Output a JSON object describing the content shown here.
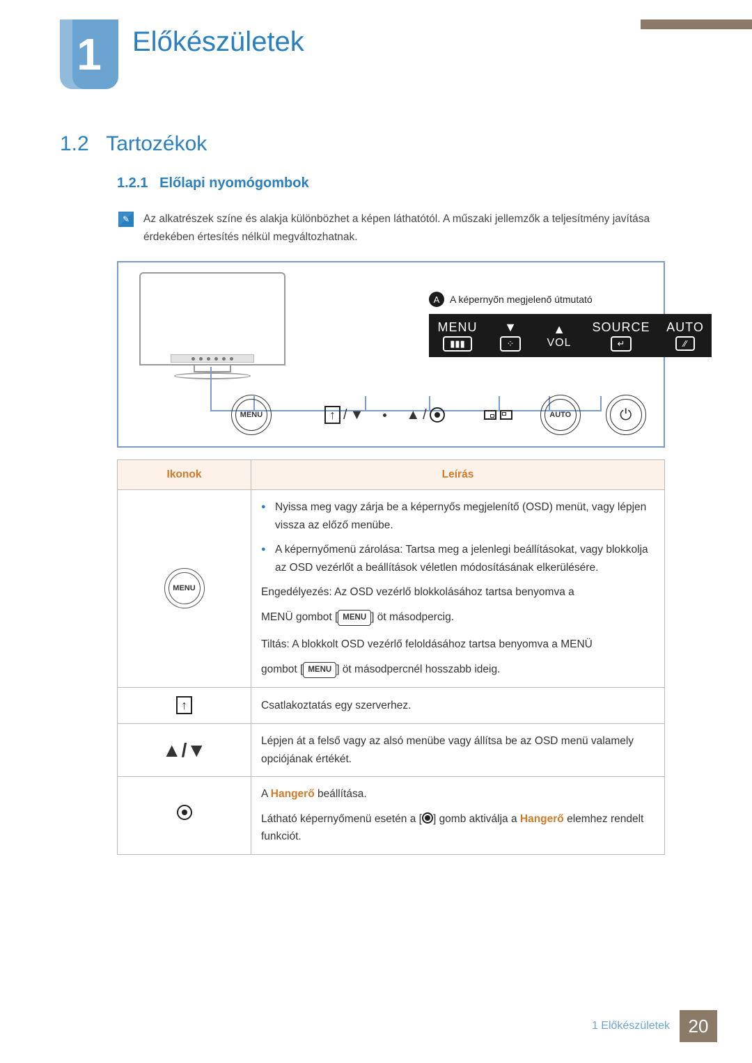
{
  "chapter": {
    "number": "1",
    "title": "Előkészületek"
  },
  "section": {
    "number": "1.2",
    "title": "Tartozékok"
  },
  "subsection": {
    "number": "1.2.1",
    "title": "Előlapi nyomógombok"
  },
  "note": "Az alkatrészek színe és alakja különbözhet a képen láthatótól. A műszaki jellemzők a teljesítmény javítása érdekében értesítés nélkül megváltozhatnak.",
  "legend_A": "A képernyőn megjelenő útmutató",
  "osd": {
    "menu": "MENU",
    "vol": "VOL",
    "source": "SOURCE",
    "auto": "AUTO"
  },
  "buttons": {
    "menu": "MENU",
    "auto": "AUTO"
  },
  "table": {
    "head": {
      "icons": "Ikonok",
      "desc": "Leírás"
    },
    "rows": {
      "menu": {
        "icon_label": "MENU",
        "b1": "Nyissa meg vagy zárja be a képernyős megjelenítő (OSD) menüt, vagy lépjen vissza az előző menübe.",
        "b2": "A képernyőmenü zárolása: Tartsa meg a jelenlegi beállításokat, vagy blokkolja az OSD vezérlőt a beállítások véletlen módosításának elkerülésére.",
        "p1a": "Engedélyezés: Az OSD vezérlő blokkolásához tartsa benyomva a",
        "p1b": "MENÜ gombot [",
        "p1c": "] öt másodpercig.",
        "p2a": "Tiltás: A blokkolt OSD vezérlő feloldásához tartsa benyomva a MENÜ",
        "p2b": "gombot [",
        "p2c": "] öt másodpercnél hosszabb ideig.",
        "inline_btn": "MENU"
      },
      "upload": "Csatlakoztatás egy szerverhez.",
      "updown": "Lépjen át a felső vagy az alsó menübe vagy állítsa be az OSD menü valamely opciójának értékét.",
      "volume": {
        "l1a": "A ",
        "l1b": "Hangerő",
        "l1c": " beállítása.",
        "l2a": "Látható képernyőmenü esetén a [",
        "l2b": "] gomb aktiválja a ",
        "l2c": "Hangerő",
        "l2d": " elemhez rendelt funkciót."
      }
    }
  },
  "footer": {
    "text": "1 Előkészületek",
    "page": "20"
  }
}
